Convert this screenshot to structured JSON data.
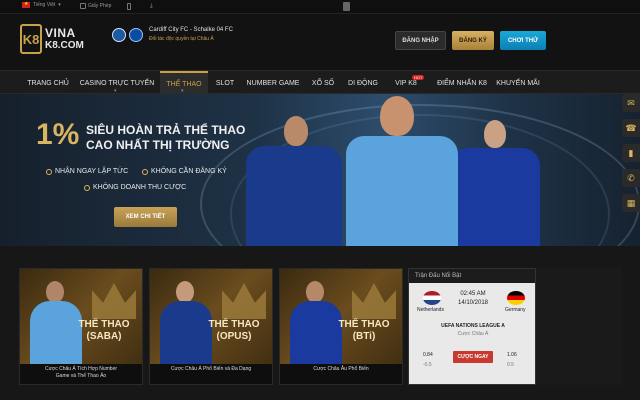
{
  "topbar": {
    "language": "Tiếng Việt",
    "license": "Giấy Phép"
  },
  "header": {
    "logo_line1": "VINA",
    "logo_line2": "K8.COM",
    "logo_mark": "K8",
    "match_title": "Cardiff City FC - Schalke 04 FC",
    "match_subtitle": "Đối tác độc quyền tại Châu Á",
    "login_label": "ĐĂNG NHẬP",
    "register_label": "ĐĂNG KÝ",
    "trial_label": "CHƠI THỬ"
  },
  "nav": {
    "items": [
      {
        "label": "TRANG CHỦ"
      },
      {
        "label": "CASINO TRỰC TUYẾN"
      },
      {
        "label": "THỂ THAO"
      },
      {
        "label": "SLOT"
      },
      {
        "label": "NUMBER GAME"
      },
      {
        "label": "XỔ SỐ"
      },
      {
        "label": "DI ĐỘNG"
      },
      {
        "label": "VIP K8"
      },
      {
        "label": "ĐIỂM NHẤN K8"
      },
      {
        "label": "KHUYẾN MÃI"
      }
    ],
    "hot_badge": "HOT",
    "active_index": 2
  },
  "banner": {
    "percent": "1%",
    "headline_line1": "SIÊU HOÀN TRẢ THỂ THAO",
    "headline_line2": "CAO NHẤT THỊ TRƯỜNG",
    "bullets": [
      "NHẬN NGAY LẬP TỨC",
      "KHÔNG CẦN ĐĂNG KÝ",
      "KHÔNG DOANH THU CƯỢC"
    ],
    "cta_label": "XEM CHI TIẾT"
  },
  "cards": [
    {
      "title_line1": "THỂ THAO",
      "title_line2": "(SABA)",
      "caption_line1": "Cược Châu Á Tích Hợp Number",
      "caption_line2": "Game và Thể Thao Ảo"
    },
    {
      "title_line1": "THỂ THAO",
      "title_line2": "(OPUS)",
      "caption_line1": "Cược Châu Á Phổ Biến và Đa Dạng",
      "caption_line2": ""
    },
    {
      "title_line1": "THỂ THAO",
      "title_line2": "(BTi)",
      "caption_line1": "Cược Châu Âu Phổ Biến",
      "caption_line2": ""
    }
  ],
  "featured": {
    "header": "Trận Đấu Nổi Bật",
    "home_team": "Netherlands",
    "away_team": "Germany",
    "time": "02:45 AM",
    "date": "14/10/2018",
    "league": "UEFA NATIONS LEAGUE A",
    "league_sub": "Cược Châu Á",
    "bet_label": "CƯỢC NGAY",
    "home_odds": "0.84",
    "home_handicap": "-0.5",
    "away_odds": "1.06",
    "away_handicap": "0.5"
  },
  "colors": {
    "gold": "#c8a24a",
    "register": "#c39a4e",
    "trial": "#1597cc",
    "bet": "#c73a2e"
  }
}
